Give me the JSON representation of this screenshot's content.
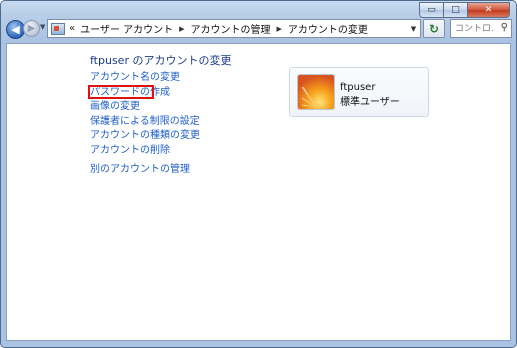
{
  "window": {
    "caption_buttons": {
      "minimize": "▭",
      "maximize": "□",
      "close": "✕"
    }
  },
  "toolbar": {
    "back_glyph": "◀",
    "forward_glyph": "▶",
    "history_dropdown_glyph": "▼",
    "address": {
      "overflow": "«",
      "breadcrumbs": [
        "ユーザー アカウント",
        "アカウントの管理",
        "アカウントの変更"
      ],
      "separator_glyph": "▶",
      "dropdown_glyph": "▼"
    },
    "refresh_glyph": "↻",
    "search": {
      "placeholder": "コントロ...",
      "icon": "search-icon"
    }
  },
  "main": {
    "heading": "ftpuser のアカウントの変更",
    "tasks": [
      {
        "label": "アカウント名の変更",
        "highlighted": false
      },
      {
        "label": "パスワードの作成",
        "highlighted": true
      },
      {
        "label": "画像の変更",
        "highlighted": false
      },
      {
        "label": "保護者による制限の設定",
        "highlighted": false
      },
      {
        "label": "アカウントの種類の変更",
        "highlighted": false
      },
      {
        "label": "アカウントの削除",
        "highlighted": false
      },
      {
        "label": "別のアカウントの管理",
        "highlighted": false
      }
    ],
    "user": {
      "name": "ftpuser",
      "account_type": "標準ユーザー"
    }
  },
  "colors": {
    "link": "#1f5ec8",
    "heading": "#1a3c8c",
    "highlight_box": "#e01010"
  }
}
